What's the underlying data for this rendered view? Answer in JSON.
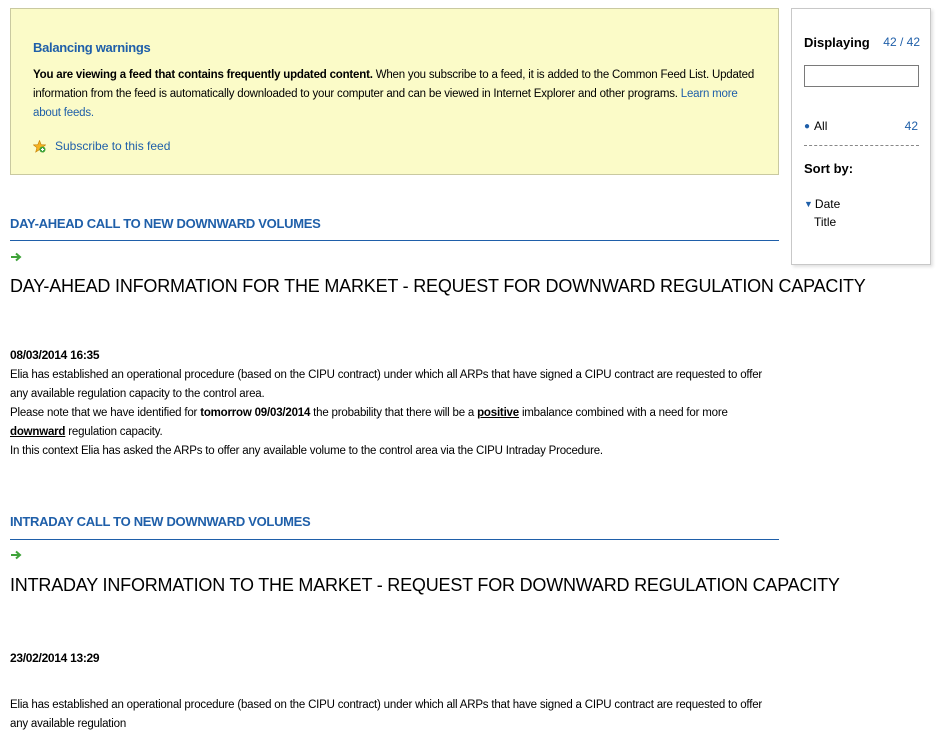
{
  "banner": {
    "title": "Balancing warnings",
    "text_bold": "You are viewing a feed that contains frequently updated content.",
    "text_rest": " When you subscribe to a feed, it is added to the Common Feed List. Updated information from the feed is automatically downloaded to your computer and can be viewed in Internet Explorer and other programs. ",
    "learn_more": "Learn more about feeds.",
    "subscribe_label": "Subscribe to this feed",
    "subscribe_icon": "feed-star-icon"
  },
  "sidebar": {
    "displaying_label": "Displaying",
    "count": "42 / 42",
    "filter_value": "",
    "all_label": "All",
    "all_count": "42",
    "sort_label": "Sort by:",
    "sort_options": [
      "Date",
      "Title"
    ]
  },
  "items": [
    {
      "section_heading": "DAY-AHEAD CALL TO NEW DOWNWARD VOLUMES",
      "title": "DAY-AHEAD INFORMATION FOR THE MARKET - REQUEST FOR DOWNWARD REGULATION CAPACITY",
      "date": "08/03/2014 16:35",
      "para1": "Elia has established an operational procedure (based on the CIPU contract) under which all ARPs that have signed a CIPU contract are requested to offer any available regulation capacity to the control area.",
      "para2_a": "Please note that we have identified for ",
      "para2_b": "tomorrow 09/03/2014",
      "para2_c": " the probability that there will be a ",
      "para2_d": "positive",
      "para2_e": " imbalance combined with a need for more ",
      "para2_f": "downward",
      "para2_g": " regulation capacity.",
      "para3": "In this context Elia has asked the ARPs to offer any available volume to the control area via the CIPU Intraday Procedure."
    },
    {
      "section_heading": "INTRADAY CALL TO NEW DOWNWARD VOLUMES",
      "title": "INTRADAY INFORMATION TO THE MARKET - REQUEST FOR DOWNWARD REGULATION CAPACITY",
      "date": "23/02/2014 13:29",
      "para1": "Elia has established an operational procedure (based on the CIPU contract) under which all ARPs that have signed a CIPU contract are requested to offer any available regulation"
    }
  ],
  "colors": {
    "link": "#1f5fa9",
    "banner_bg": "#fbfbc8",
    "arrow": "#3fa33a"
  }
}
